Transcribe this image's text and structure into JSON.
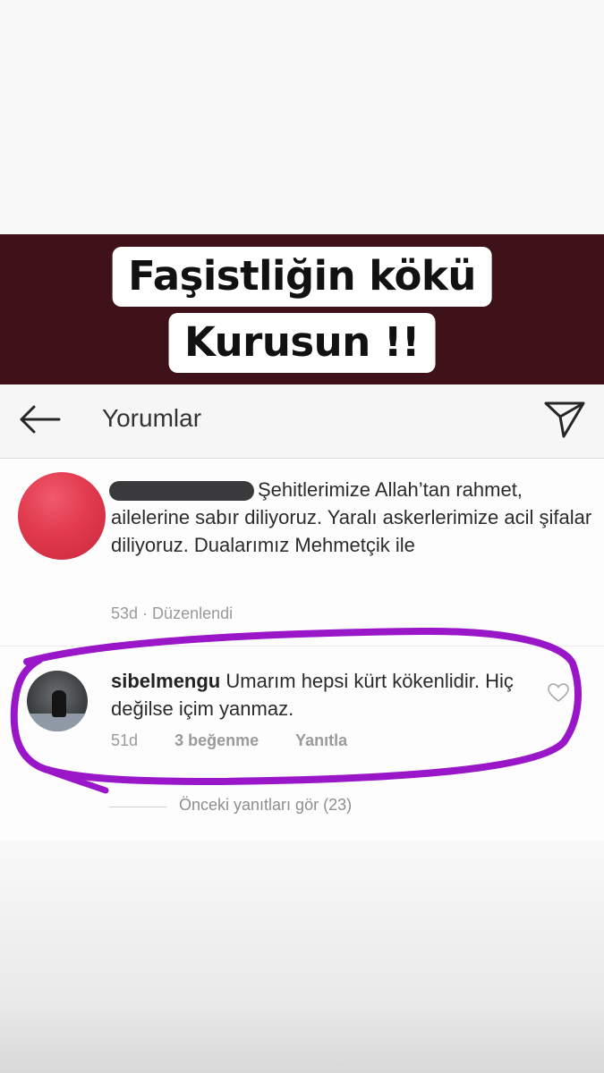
{
  "banner": {
    "line1": "Faşistliğin kökü",
    "line2": "Kurusun !!"
  },
  "header": {
    "title": "Yorumlar",
    "back_icon": "arrow-left-icon",
    "send_icon": "paper-plane-icon"
  },
  "comments": [
    {
      "username": "",
      "text": "Şehitlerimize Allah’tan rahmet, ailelerine sabır diliyoruz. Yaralı askerlerimize acil şifalar diliyoruz. Dualarımız Mehmetçik ile",
      "time": "53d",
      "edited": "· Düzenlendi"
    },
    {
      "username": "sibelmengu",
      "text": "Umarım hepsi kürt kökenlidir. Hiç değilse içim yanmaz.",
      "time": "51d",
      "likes": "3 beğenme",
      "reply": "Yanıtla"
    }
  ],
  "prev_replies": "Önceki yanıtları gör (23)",
  "colors": {
    "banner_bg": "#3f1219",
    "annotation": "#9a17c9"
  }
}
